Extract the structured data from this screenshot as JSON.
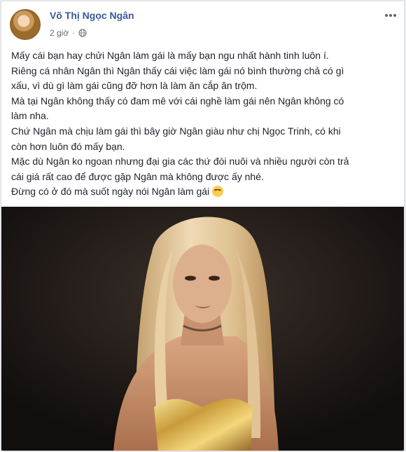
{
  "author": {
    "name": "Võ Thị Ngọc Ngân",
    "time": "2 giờ",
    "separator": "·",
    "privacy_icon": "globe-icon",
    "avatar_icon": "profile-photo"
  },
  "post": {
    "lines": [
      "Mấy cái bạn hay chửi Ngân làm gái là mấy bạn ngu nhất hành tinh luôn í.",
      "Riêng cá nhân Ngân thì Ngân thấy cái việc làm gái nó bình thường chả có gì",
      "xấu, vì dù gì làm gái cũng đỡ hơn là làm ăn cắp ăn trộm.",
      "Mà tại Ngân không thấy có đam mê với cái nghề làm gái nên Ngân không có",
      "làm nha.",
      "Chứ Ngân mà chịu làm gái thì bây giờ Ngân giàu như chị Ngọc Trinh, có khi",
      "còn hơn luôn đó mấy bạn.",
      "Mặc dù Ngân ko ngoan nhưng đại gia các thứ đòi nuôi và nhiều người còn trả",
      "cái giá rất cao để được gặp Ngân mà không được ấy nhé.",
      "Đừng có ở đó mà suốt ngày nói Ngân làm gái"
    ],
    "last_line_emoji": "relieved-face-emoji"
  },
  "menu": {
    "more_icon": "more-horizontal-icon"
  },
  "photo": {
    "subject": "portrait-photo"
  },
  "colors": {
    "author_name": "#385898",
    "body_text": "#1d2129",
    "meta_text": "#616770",
    "page_bg": "#e9ebee",
    "photo_bg": "#1a1615"
  }
}
